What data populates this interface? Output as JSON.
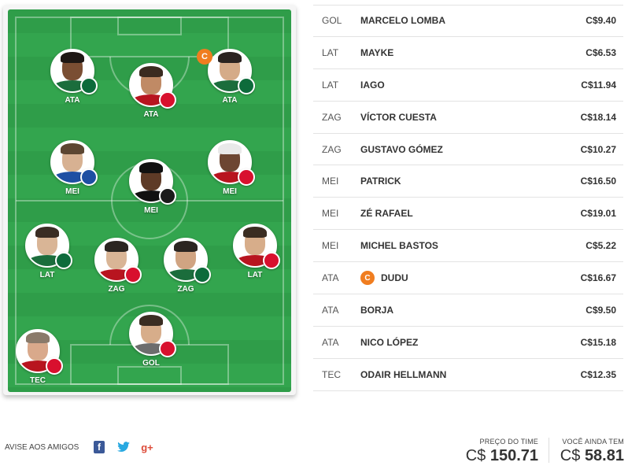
{
  "field": {
    "players": [
      {
        "pos": "ATA",
        "club": "pal",
        "club_icon": "palmeiras-crest-icon",
        "shirt": "#1b6d3c",
        "hair": "#1e1714",
        "skin": "#7a4e33"
      },
      {
        "pos": "ATA",
        "club": "int",
        "club_icon": "internacional-crest-icon",
        "shirt": "#b8141f",
        "hair": "#3b2b20",
        "skin": "#c08a65"
      },
      {
        "pos": "ATA",
        "club": "pal",
        "club_icon": "palmeiras-crest-icon",
        "shirt": "#1b6d3c",
        "hair": "#2a2320",
        "skin": "#d5ab88",
        "captain": "C"
      },
      {
        "pos": "MEI",
        "club": "bah",
        "club_icon": "bahia-crest-icon",
        "shirt": "#1e4fa3",
        "hair": "#5c4632",
        "skin": "#d7b192"
      },
      {
        "pos": "MEI",
        "club": "spt",
        "club_icon": "sport-crest-icon",
        "shirt": "#111111",
        "hair": "#111111",
        "skin": "#5e3b27"
      },
      {
        "pos": "MEI",
        "club": "int",
        "club_icon": "internacional-crest-icon",
        "shirt": "#b8141f",
        "hair": "#e9e9e9",
        "skin": "#6d4632"
      },
      {
        "pos": "LAT",
        "club": "pal",
        "club_icon": "palmeiras-crest-icon",
        "shirt": "#1b6d3c",
        "hair": "#3a2d24",
        "skin": "#d9b596"
      },
      {
        "pos": "ZAG",
        "club": "int",
        "club_icon": "internacional-crest-icon",
        "shirt": "#b8141f",
        "hair": "#2b2521",
        "skin": "#d9b596"
      },
      {
        "pos": "ZAG",
        "club": "pal",
        "club_icon": "palmeiras-crest-icon",
        "shirt": "#1b6d3c",
        "hair": "#2b2521",
        "skin": "#d0a482"
      },
      {
        "pos": "LAT",
        "club": "int",
        "club_icon": "internacional-crest-icon",
        "shirt": "#b8141f",
        "hair": "#3b2d22",
        "skin": "#d7ad8a"
      },
      {
        "pos": "GOL",
        "club": "int",
        "club_icon": "internacional-crest-icon",
        "shirt": "#6d6d6d",
        "hair": "#3b2d22",
        "skin": "#d7ad8a"
      },
      {
        "pos": "TEC",
        "club": "int",
        "club_icon": "internacional-crest-icon",
        "shirt": "#b8141f",
        "hair": "#8a7a6a",
        "skin": "#d9a98b"
      }
    ]
  },
  "roster": [
    {
      "pos": "GOL",
      "name": "MARCELO LOMBA",
      "price": "C$9.40"
    },
    {
      "pos": "LAT",
      "name": "MAYKE",
      "price": "C$6.53"
    },
    {
      "pos": "LAT",
      "name": "IAGO",
      "price": "C$11.94"
    },
    {
      "pos": "ZAG",
      "name": "VÍCTOR CUESTA",
      "price": "C$18.14"
    },
    {
      "pos": "ZAG",
      "name": "GUSTAVO GÓMEZ",
      "price": "C$10.27"
    },
    {
      "pos": "MEI",
      "name": "PATRICK",
      "price": "C$16.50"
    },
    {
      "pos": "MEI",
      "name": "ZÉ RAFAEL",
      "price": "C$19.01"
    },
    {
      "pos": "MEI",
      "name": "MICHEL BASTOS",
      "price": "C$5.22"
    },
    {
      "pos": "ATA",
      "name": "DUDU",
      "price": "C$16.67",
      "captain": "C"
    },
    {
      "pos": "ATA",
      "name": "BORJA",
      "price": "C$9.50"
    },
    {
      "pos": "ATA",
      "name": "NICO LÓPEZ",
      "price": "C$15.18"
    },
    {
      "pos": "TEC",
      "name": "ODAIR HELLMANN",
      "price": "C$12.35"
    }
  ],
  "footer": {
    "share_label": "AVISE AOS AMIGOS",
    "facebook_glyph": "f",
    "twitter_glyph": "🐦",
    "gplus_glyph": "g+",
    "team_price_label": "PREÇO DO TIME",
    "team_price_currency": "C$",
    "team_price_value": "150.71",
    "balance_label": "VOCÊ AINDA TEM",
    "balance_currency": "C$",
    "balance_value": "58.81"
  },
  "colors": {
    "field_green": "#2f9d49",
    "captain_orange": "#f07d1f"
  }
}
